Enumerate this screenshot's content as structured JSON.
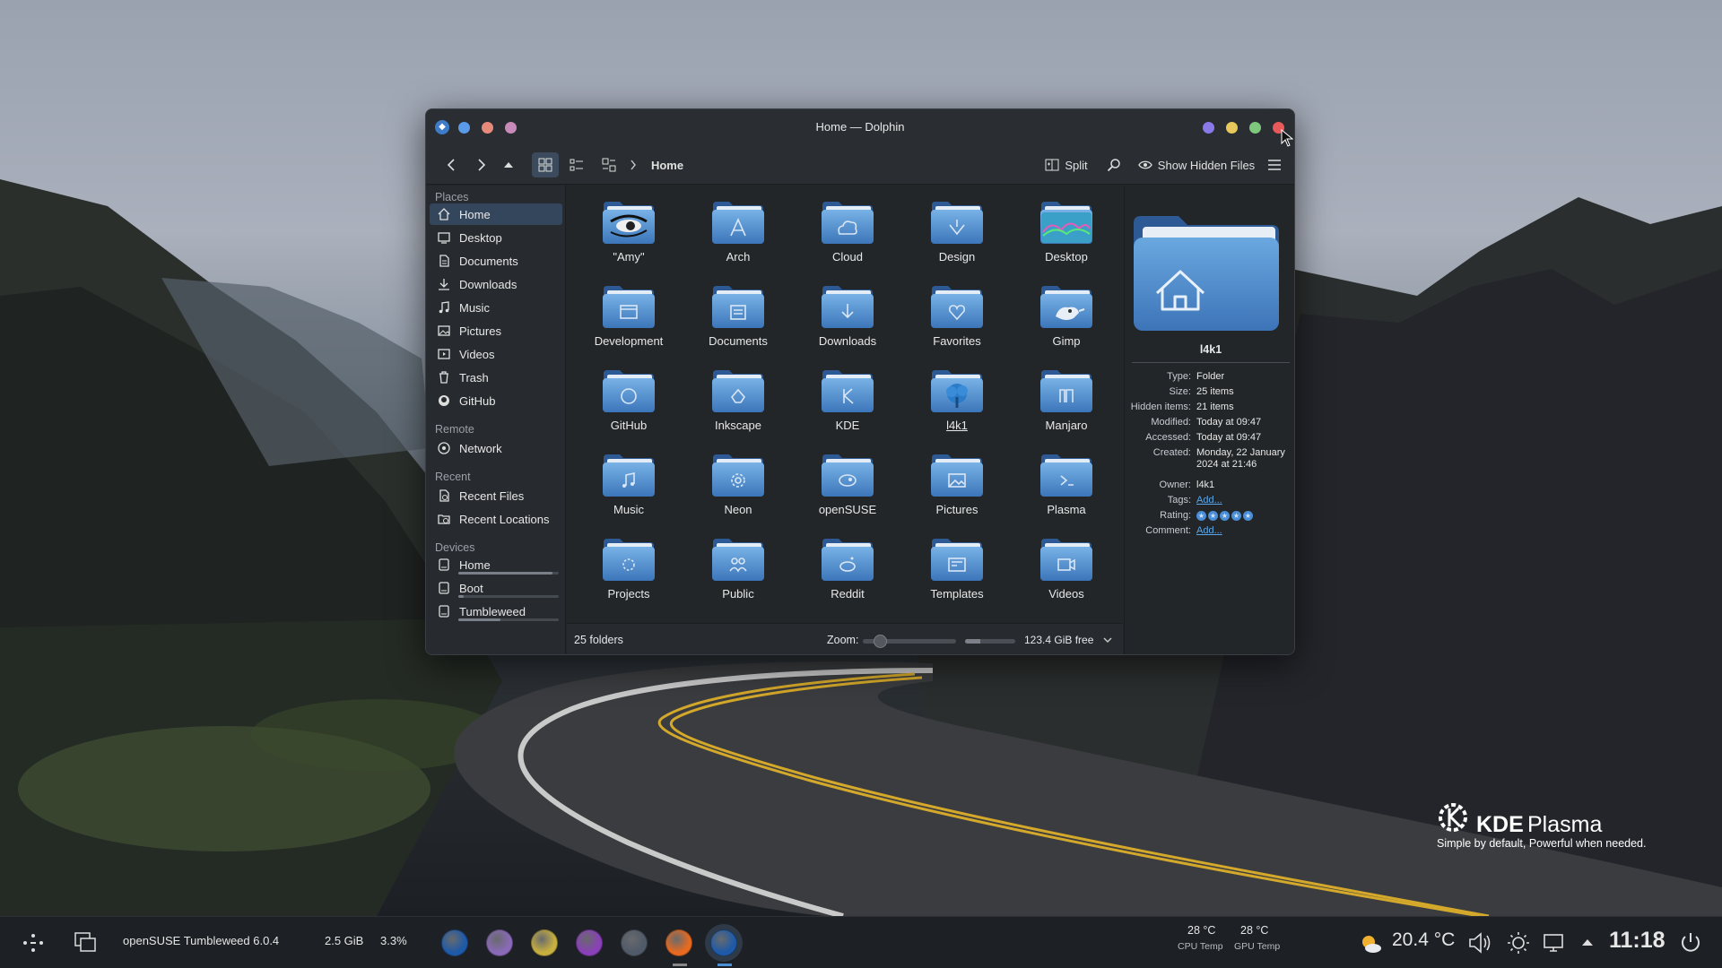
{
  "window": {
    "title": "Home — Dolphin",
    "app_icon": "dolphin-icon",
    "title_buttons": [
      "#8a7ae8",
      "#e8c85a",
      "#7ec87e",
      "#e85a5a"
    ],
    "left_dots": [
      "#5a9ae8",
      "#e88a7a",
      "#c88ab8"
    ]
  },
  "toolbar": {
    "back": "arrow-left-icon",
    "forward": "arrow-right-icon",
    "up": "arrow-up-icon",
    "breadcrumb": "Home",
    "split_label": "Split",
    "show_hidden_label": "Show Hidden Files"
  },
  "sidebar": {
    "places_header": "Places",
    "places": [
      {
        "label": "Home",
        "icon": "home-icon"
      },
      {
        "label": "Desktop",
        "icon": "desktop-icon"
      },
      {
        "label": "Documents",
        "icon": "documents-icon"
      },
      {
        "label": "Downloads",
        "icon": "downloads-icon"
      },
      {
        "label": "Music",
        "icon": "music-icon"
      },
      {
        "label": "Pictures",
        "icon": "pictures-icon"
      },
      {
        "label": "Videos",
        "icon": "videos-icon"
      },
      {
        "label": "Trash",
        "icon": "trash-icon"
      },
      {
        "label": "GitHub",
        "icon": "github-icon"
      }
    ],
    "remote_header": "Remote",
    "remote": [
      {
        "label": "Network",
        "icon": "network-icon"
      }
    ],
    "recent_header": "Recent",
    "recent": [
      {
        "label": "Recent Files",
        "icon": "recent-files-icon"
      },
      {
        "label": "Recent Locations",
        "icon": "recent-locations-icon"
      }
    ],
    "devices_header": "Devices",
    "devices": [
      {
        "label": "Home",
        "icon": "drive-icon",
        "usage": 0.94
      },
      {
        "label": "Boot",
        "icon": "drive-icon",
        "usage": 0.05
      },
      {
        "label": "Tumbleweed",
        "icon": "drive-icon",
        "usage": 0.42
      }
    ]
  },
  "folders": [
    "\"Amy\"",
    "Arch",
    "Cloud",
    "Design",
    "Desktop",
    "Development",
    "Documents",
    "Downloads",
    "Favorites",
    "Gimp",
    "GitHub",
    "Inkscape",
    "KDE",
    "l4k1",
    "Manjaro",
    "Music",
    "Neon",
    "openSUSE",
    "Pictures",
    "Plasma",
    "Projects",
    "Public",
    "Reddit",
    "Templates",
    "Videos"
  ],
  "status": {
    "count": "25 folders",
    "zoom_label": "Zoom:",
    "free": "123.4 GiB free",
    "zoom_level": 0.18,
    "disk_used": 0.3
  },
  "info": {
    "name": "l4k1",
    "rows": [
      {
        "k": "Type:",
        "v": "Folder"
      },
      {
        "k": "Size:",
        "v": "25 items"
      },
      {
        "k": "Hidden items:",
        "v": "21 items"
      },
      {
        "k": "Modified:",
        "v": "Today at 09:47"
      },
      {
        "k": "Accessed:",
        "v": "Today at 09:47"
      },
      {
        "k": "Created:",
        "v": "Monday, 22 January 2024 at 21:46"
      },
      {
        "k": "Owner:",
        "v": "l4k1"
      },
      {
        "k": "Tags:",
        "v": "Add..."
      },
      {
        "k": "Rating:",
        "v": ""
      },
      {
        "k": "Comment:",
        "v": "Add..."
      }
    ],
    "rating": 5
  },
  "taskbar": {
    "os": "openSUSE Tumbleweed 6.0.4",
    "mem": "2.5 GiB",
    "cpu": "3.3%",
    "cpu_temp": "28 °C",
    "cpu_temp_label": "CPU Temp",
    "gpu_temp": "28 °C",
    "gpu_temp_label": "GPU Temp",
    "weather": "20.4 °C",
    "clock": "11:18",
    "apps": [
      "#1e5aa8",
      "#8a6ab8",
      "#c8b040",
      "#8a40b8",
      "#505a68",
      "#e86a20",
      "#1e5aa8"
    ]
  },
  "kde": {
    "brand": "KDE",
    "product": "Plasma",
    "tagline": "Simple by default, Powerful when needed."
  }
}
